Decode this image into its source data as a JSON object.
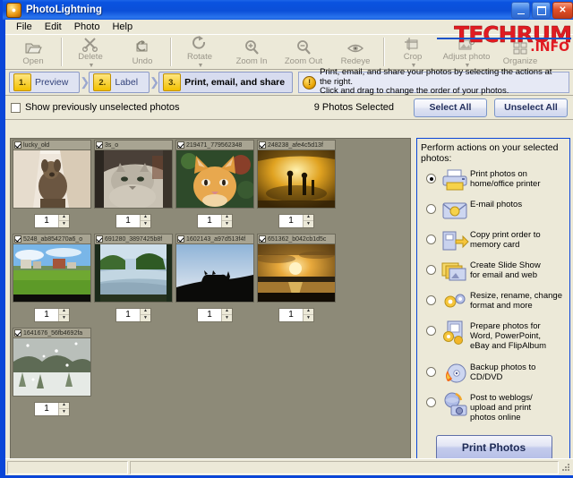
{
  "window": {
    "title": "PhotoLightning",
    "app_icon": "photo-app-icon",
    "minimize_label": "Minimize",
    "maximize_label": "Maximize",
    "close_label": "Close"
  },
  "menubar": [
    {
      "label": "File"
    },
    {
      "label": "Edit"
    },
    {
      "label": "Photo"
    },
    {
      "label": "Help"
    }
  ],
  "toolbar": [
    {
      "label": "Open",
      "icon": "open-folder-icon",
      "dropdown": false
    },
    {
      "label": "Delete",
      "icon": "scissors-delete-icon",
      "dropdown": true
    },
    {
      "label": "Undo",
      "icon": "undo-arrow-icon",
      "dropdown": false
    },
    {
      "label": "Rotate",
      "icon": "rotate-icon",
      "dropdown": true
    },
    {
      "label": "Zoom In",
      "icon": "zoom-in-icon",
      "dropdown": false
    },
    {
      "label": "Zoom Out",
      "icon": "zoom-out-icon",
      "dropdown": false
    },
    {
      "label": "Redeye",
      "icon": "redeye-icon",
      "dropdown": false
    },
    {
      "label": "Crop",
      "icon": "crop-icon",
      "dropdown": true
    },
    {
      "label": "Adjust photo",
      "icon": "adjust-photo-icon",
      "dropdown": true
    },
    {
      "label": "Organize",
      "icon": "organize-icon",
      "dropdown": false
    }
  ],
  "watermark": {
    "line1": "TECHRUM",
    "line2": ".INFO"
  },
  "steps": [
    {
      "num": "1.",
      "label": "Preview",
      "active": false
    },
    {
      "num": "2.",
      "label": "Label",
      "active": false
    },
    {
      "num": "3.",
      "label": "Print, email, and share",
      "active": true
    }
  ],
  "hint": {
    "icon": "info-exclamation-icon",
    "line1": "Print, email, and share your photos by selecting the actions at the right.",
    "line2": "Click and drag to change the order of your photos."
  },
  "selection_bar": {
    "show_unselected_checked": false,
    "show_unselected_label": "Show previously unselected photos",
    "count_text": "9  Photos Selected",
    "select_all_label": "Select All",
    "unselect_all_label": "Unselect All"
  },
  "photos": [
    {
      "name": "lucky_old",
      "checked": true,
      "qty": "1",
      "scene": "sepia-dog"
    },
    {
      "name": "3s_o",
      "checked": true,
      "qty": "1",
      "scene": "grey-kitten"
    },
    {
      "name": "219471_779562348",
      "checked": true,
      "qty": "1",
      "scene": "orange-cat"
    },
    {
      "name": "248238_afe4c5d13f",
      "checked": true,
      "qty": "1",
      "scene": "golden-burst"
    },
    {
      "name": "5248_ab854270a6_o",
      "checked": true,
      "qty": "1",
      "scene": "green-field"
    },
    {
      "name": "691280_3897425b8f",
      "checked": true,
      "qty": "1",
      "scene": "river-trees"
    },
    {
      "name": "1602143_a97d513f4f",
      "checked": true,
      "qty": "1",
      "scene": "cat-silhouette"
    },
    {
      "name": "651362_b042cb1d5c",
      "checked": true,
      "qty": "1",
      "scene": "sunset-lake"
    },
    {
      "name": "1641676_56fb4692fa",
      "checked": true,
      "qty": "1",
      "scene": "snow-scene"
    }
  ],
  "actions_panel": {
    "title": "Perform actions on your selected photos:",
    "options": [
      {
        "selected": true,
        "icon": "printer-icon",
        "line1": "Print photos on",
        "line2": "home/office printer",
        "line3": ""
      },
      {
        "selected": false,
        "icon": "email-icon",
        "line1": "E-mail photos",
        "line2": "",
        "line3": ""
      },
      {
        "selected": false,
        "icon": "memory-card-icon",
        "line1": "Copy print order to",
        "line2": "memory card",
        "line3": ""
      },
      {
        "selected": false,
        "icon": "slideshow-icon",
        "line1": "Create Slide Show",
        "line2": "for email and web",
        "line3": ""
      },
      {
        "selected": false,
        "icon": "gears-icon",
        "line1": "Resize, rename, change",
        "line2": "format and more",
        "line3": ""
      },
      {
        "selected": false,
        "icon": "prepare-docs-icon",
        "line1": "Prepare photos for",
        "line2": "Word, PowerPoint,",
        "line3": "eBay and FlipAlbum"
      },
      {
        "selected": false,
        "icon": "cd-burn-icon",
        "line1": "Backup photos to",
        "line2": "CD/DVD",
        "line3": ""
      },
      {
        "selected": false,
        "icon": "upload-web-icon",
        "line1": "Post to weblogs/",
        "line2": "upload and print",
        "line3": "photos online"
      }
    ],
    "primary_button": "Print Photos"
  },
  "hscrollbar": {
    "left_arrow": "‹",
    "right_arrow": "›"
  },
  "colors": {
    "titlebar_blue": "#0a46d8",
    "panel_beige": "#ece9d8",
    "photo_pane_grey": "#8d8a78",
    "accent_yellow": "#f2c000",
    "watermark_red": "#e11b22"
  }
}
